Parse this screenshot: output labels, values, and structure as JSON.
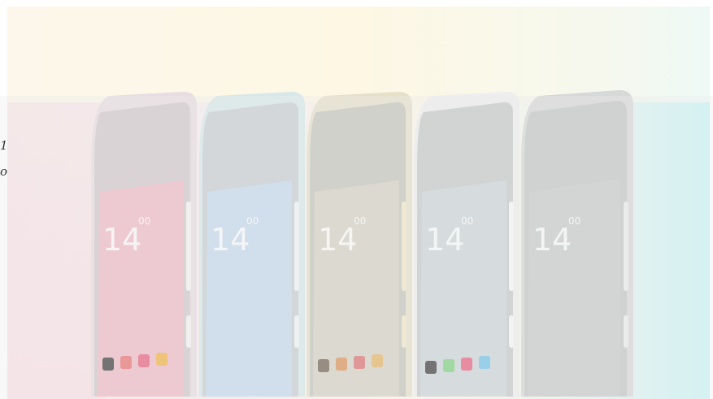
{
  "partial_text": {
    "line1": "1",
    "line2": "o"
  },
  "phones": [
    {
      "name": "pink",
      "screen_color": "#f3b8c8",
      "frame_color": "#f2dfe4",
      "clock": "14",
      "clock_sup": "00"
    },
    {
      "name": "blue",
      "screen_color": "#c5d8ec",
      "frame_color": "#cfe9ee",
      "clock": "14",
      "clock_sup": "00"
    },
    {
      "name": "yellow",
      "screen_color": "#dcd7c6",
      "frame_color": "#efe6c2",
      "clock": "14",
      "clock_sup": "00"
    },
    {
      "name": "white",
      "screen_color": "#cfd6d8",
      "frame_color": "#f1f2f0",
      "clock": "14",
      "clock_sup": "00"
    },
    {
      "name": "gray",
      "screen_color": "#c9cccb",
      "frame_color": "#dedfdf",
      "clock": "14",
      "clock_sup": "00"
    }
  ]
}
